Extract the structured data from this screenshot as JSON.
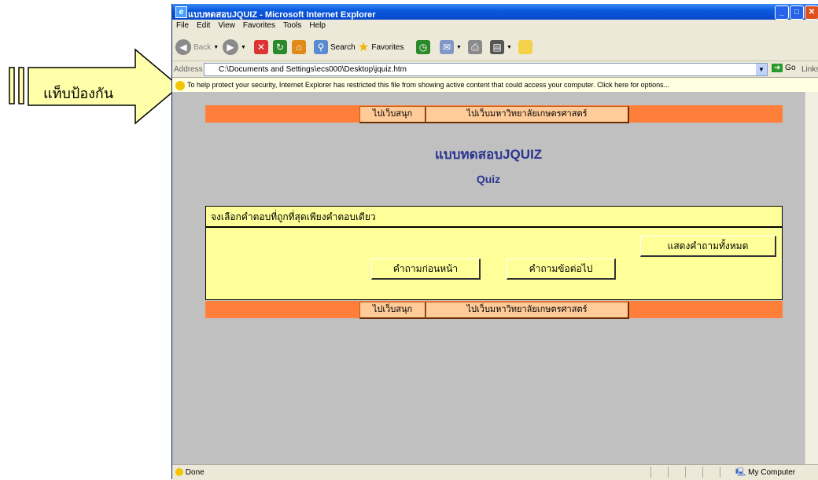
{
  "callout": {
    "text": "แท็บป้องกัน"
  },
  "window": {
    "title": "แบบทดสอบJQUIZ - Microsoft Internet Explorer",
    "controls": [
      "_",
      "□",
      "✕"
    ]
  },
  "menu": [
    "File",
    "Edit",
    "View",
    "Favorites",
    "Tools",
    "Help"
  ],
  "toolbar": {
    "back": "Back",
    "search": "Search",
    "favorites": "Favorites"
  },
  "address": {
    "label": "Address",
    "url": "C:\\Documents and Settings\\ecs000\\Desktop\\jquiz.htm",
    "go": "Go",
    "links": "Links"
  },
  "infobar": {
    "text": "To help protect your security, Internet Explorer has restricted this file from showing active content that could access your computer. Click here for options..."
  },
  "nav": {
    "fun": "ไปเว็บสนุก",
    "ku": "ไปเว็บมหาวิทยาลัยเกษตรศาสตร์"
  },
  "page": {
    "title": "แบบทดสอบJQUIZ",
    "subtitle": "Quiz"
  },
  "quiz": {
    "instruction": "จงเลือกคำตอบที่ถูกที่สุดเพียงคำตอบเดียว",
    "show_all": "แสดงคำถามทั้งหมด",
    "prev": "คำถามก่อนหน้า",
    "next": "คำถามข้อต่อไป"
  },
  "status": {
    "left": "Done",
    "right": "My Computer"
  }
}
